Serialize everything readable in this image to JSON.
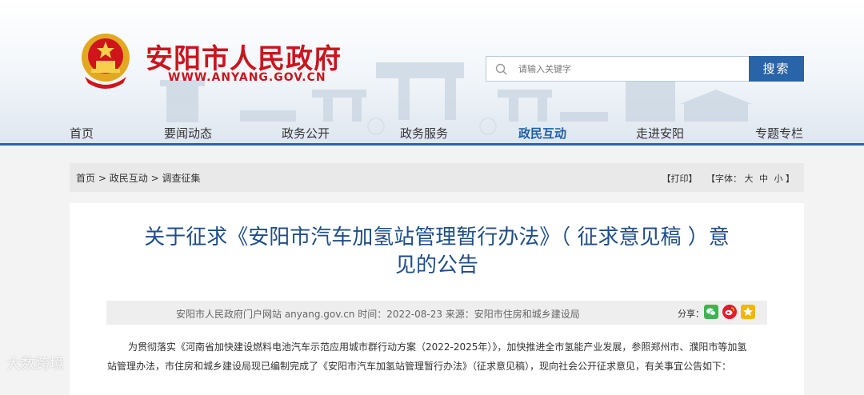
{
  "header": {
    "site_title": "安阳市人民政府",
    "site_url": "WWW.ANYANG.GOV.CN",
    "search_placeholder": "请输入关键字",
    "search_button": "搜索"
  },
  "nav": {
    "items": [
      "首页",
      "要闻动态",
      "政务公开",
      "政务服务",
      "政民互动",
      "走进安阳",
      "专题专栏"
    ],
    "active": "政民互动"
  },
  "breadcrumb": [
    "首页",
    ">",
    "政民互动",
    ">",
    "调查征集"
  ],
  "page_tools": {
    "print": "【打印】",
    "font_label": "【字体：",
    "font_large": "大",
    "font_medium": "中",
    "font_small": "小",
    "font_close": "】"
  },
  "article": {
    "title_line1": "关于征求《安阳市汽车加氢站管理暂行办法》（ 征求意见稿 ）意",
    "title_line2": "见的公告",
    "meta": "安阳市人民政府门户网站 anyang.gov.cn    时间：2022-08-23    来源：安阳市住房和城乡建设局",
    "share_label": "分享：",
    "body_line1": "为贯彻落实《河南省加快建设燃料电池汽车示范应用城市群行动方案（2022-2025年）》，加快推进全市氢能产业发展，参照郑州市、濮阳市等加氢",
    "body_line2": "站管理办法，市住房和城乡建设局现已编制完成了《安阳市汽车加氢站管理暂行办法》（征求意见稿），现向社会公开征求意见，有关事宜公告如下："
  },
  "share_icons": [
    {
      "name": "wechat-icon",
      "color": "#3fb34f"
    },
    {
      "name": "weibo-icon",
      "color": "#e6162d"
    },
    {
      "name": "qzone-icon",
      "color": "#f5b400"
    }
  ],
  "watermark": "大数跨境",
  "colors": {
    "brand_red": "#c8161d",
    "nav_blue": "#2963a8",
    "title_blue": "#1f4e89"
  }
}
